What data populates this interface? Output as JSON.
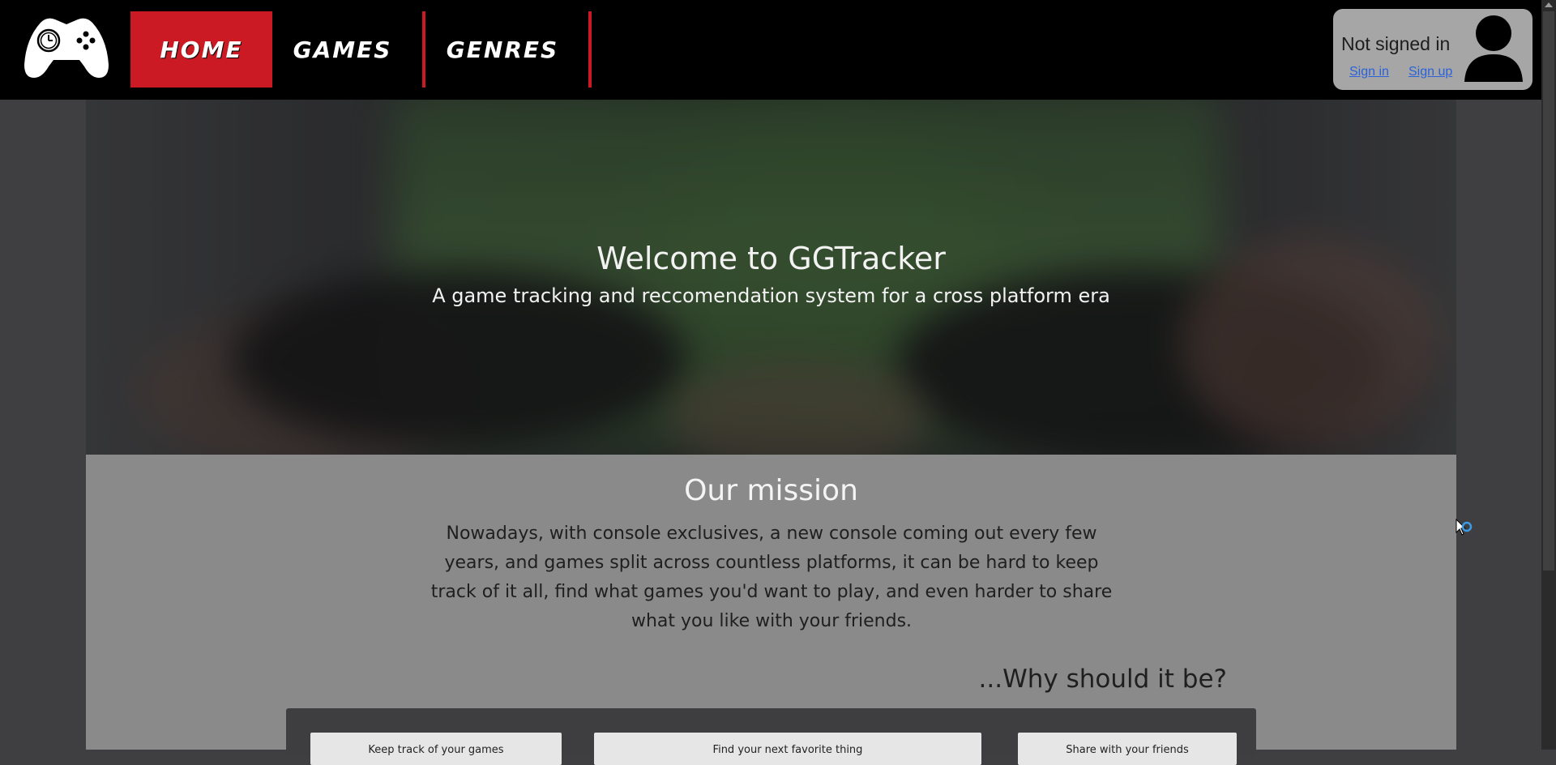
{
  "nav": {
    "items": [
      {
        "label": "Home",
        "active": true
      },
      {
        "label": "Games",
        "active": false
      },
      {
        "label": "Genres",
        "active": false
      }
    ],
    "accent_color": "#cc1a24"
  },
  "account": {
    "status": "Not signed in",
    "signin_label": "Sign in",
    "signup_label": "Sign up"
  },
  "hero": {
    "title": "Welcome to GGTracker",
    "subtitle": "A game tracking and reccomendation system for a cross platform era"
  },
  "mission": {
    "title": "Our mission",
    "text": "Nowadays, with console exclusives, a new console coming out every few years, and games split across countless platforms, it can be hard to keep track of it all, find what games you'd want to play, and even harder to share what you like with your friends."
  },
  "why": {
    "title": "...Why should it be?"
  },
  "features": [
    {
      "label": "Keep track of your games"
    },
    {
      "label": "Find your next favorite thing"
    },
    {
      "label": "Share with your friends"
    }
  ]
}
